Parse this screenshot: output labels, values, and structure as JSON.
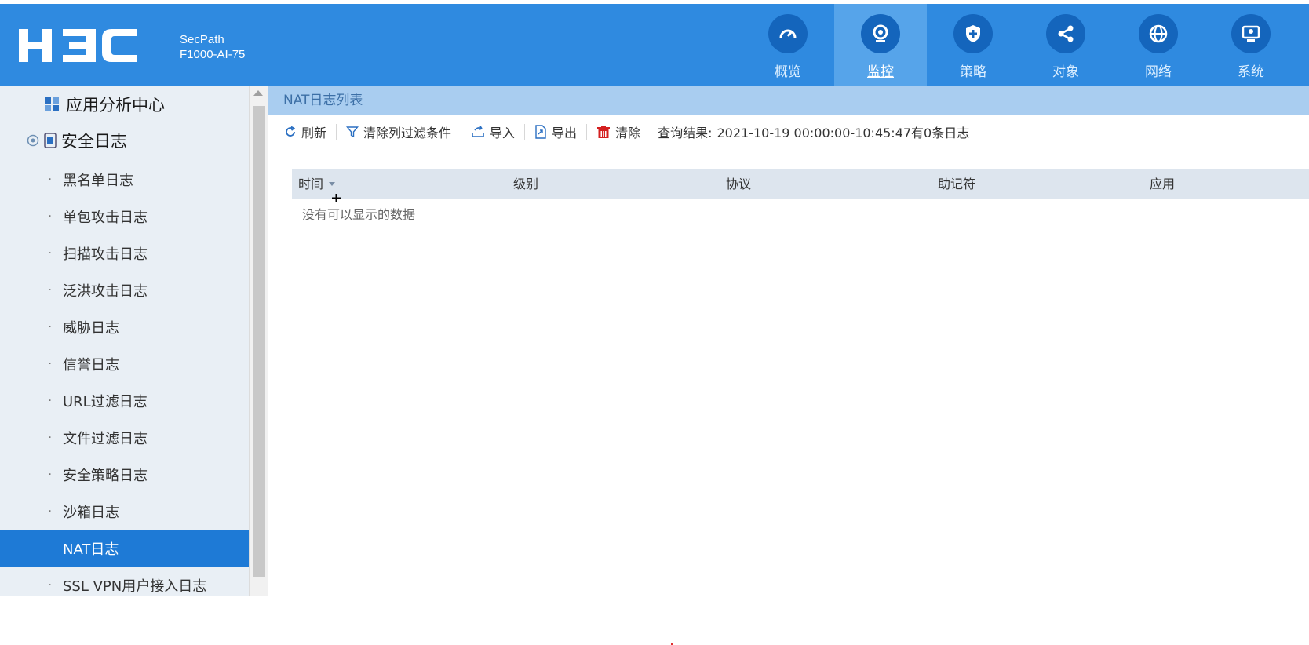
{
  "header": {
    "brand": "H3C",
    "product_line1": "SecPath",
    "product_line2": "F1000-AI-75",
    "nav": [
      {
        "label": "概览",
        "icon": "dashboard-icon",
        "active": false
      },
      {
        "label": "监控",
        "icon": "monitor-camera-icon",
        "active": true
      },
      {
        "label": "策略",
        "icon": "shield-icon",
        "active": false
      },
      {
        "label": "对象",
        "icon": "share-icon",
        "active": false
      },
      {
        "label": "网络",
        "icon": "globe-icon",
        "active": false
      },
      {
        "label": "系统",
        "icon": "system-screen-icon",
        "active": false
      }
    ]
  },
  "sidebar": {
    "group1": "应用分析中心",
    "group2": "安全日志",
    "items": [
      {
        "label": "黑名单日志"
      },
      {
        "label": "单包攻击日志"
      },
      {
        "label": "扫描攻击日志"
      },
      {
        "label": "泛洪攻击日志"
      },
      {
        "label": "威胁日志"
      },
      {
        "label": "信誉日志"
      },
      {
        "label": "URL过滤日志"
      },
      {
        "label": "文件过滤日志"
      },
      {
        "label": "安全策略日志"
      },
      {
        "label": "沙箱日志"
      },
      {
        "label": "NAT日志",
        "active": true
      },
      {
        "label": "SSL VPN用户接入日志"
      }
    ]
  },
  "main": {
    "title": "NAT日志列表",
    "toolbar": {
      "refresh": "刷新",
      "clear_filter": "清除列过滤条件",
      "import": "导入",
      "export": "导出",
      "clear": "清除",
      "query_label": "查询结果:",
      "query_value": "2021-10-19 00:00:00-10:45:47有0条日志"
    },
    "columns": [
      "时间",
      "级别",
      "协议",
      "助记符",
      "应用"
    ],
    "empty_text": "没有可以显示的数据"
  },
  "colors": {
    "header_bg": "#2f8ae0",
    "nav_active_bg": "#56a4ea",
    "sidebar_active": "#1e7ad6",
    "clear_icon": "#d42020"
  }
}
